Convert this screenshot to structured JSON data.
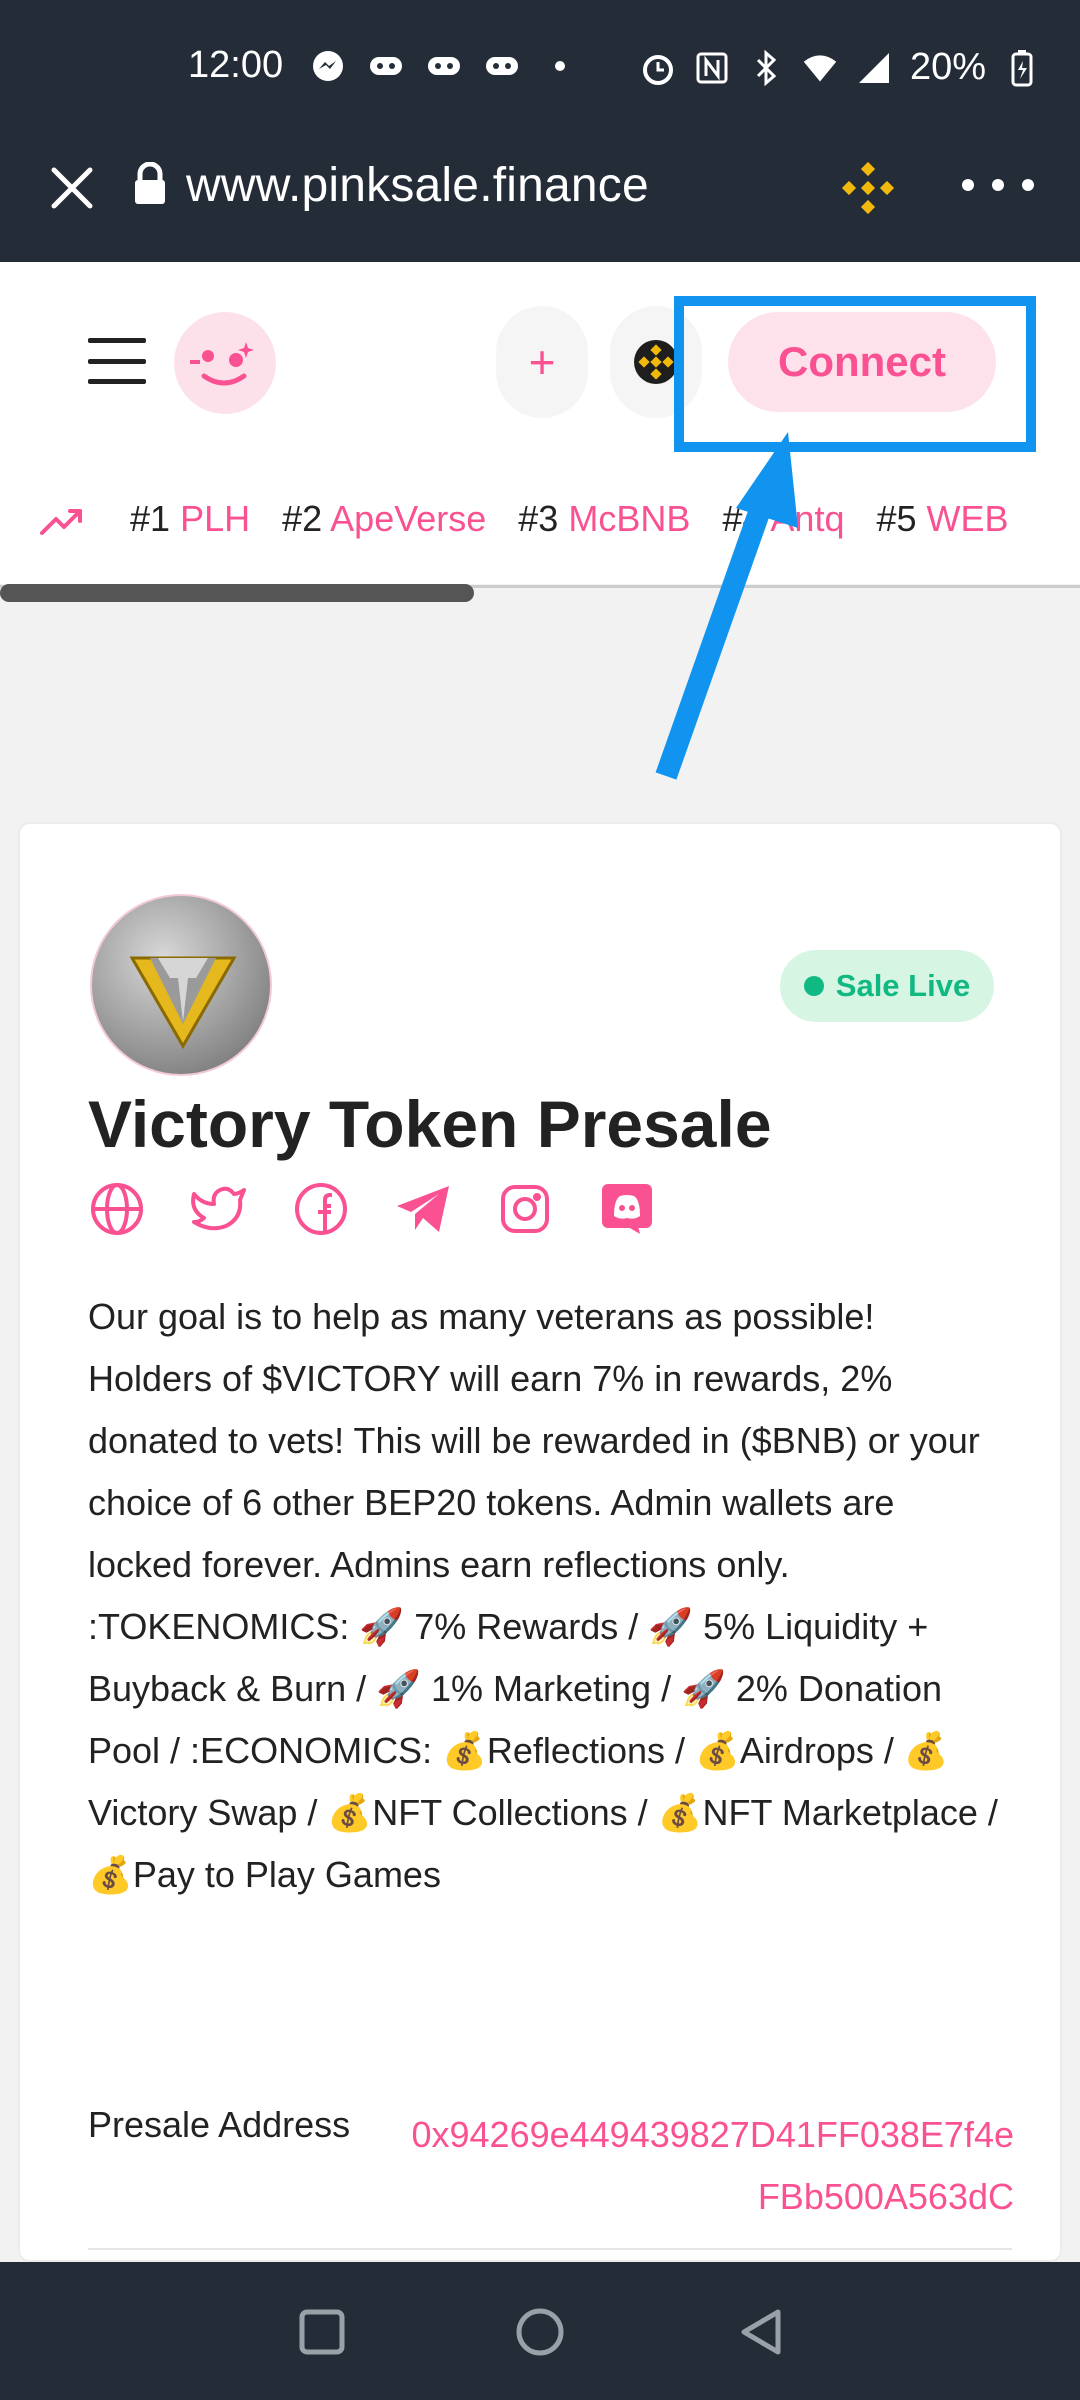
{
  "status_bar": {
    "time": "12:00",
    "battery": "20%"
  },
  "browser": {
    "url": "www.pinksale.finance"
  },
  "header": {
    "connect_label": "Connect",
    "add_label": "+"
  },
  "trending": [
    {
      "rank": "#1",
      "name": "PLH"
    },
    {
      "rank": "#2",
      "name": "ApeVerse"
    },
    {
      "rank": "#3",
      "name": "McBNB"
    },
    {
      "rank": "#4",
      "name": "Antq"
    },
    {
      "rank": "#5",
      "name": "WEB"
    }
  ],
  "presale": {
    "status": "Sale Live",
    "title": "Victory Token Presale",
    "description": "Our goal is to help as many veterans as possible! Holders of $VICTORY will earn 7% in rewards, 2% donated to vets! This will be rewarded in ($BNB) or your choice of 6 other BEP20 tokens. Admin wallets are locked forever. Admins earn reflections only. :TOKENOMICS: 🚀 7% Rewards / 🚀 5% Liquidity + Buyback & Burn / 🚀 1% Marketing / 🚀 2% Donation Pool / :ECONOMICS: 💰Reflections / 💰Airdrops / 💰Victory Swap / 💰NFT Collections / 💰NFT Marketplace / 💰Pay to Play Games",
    "address_label": "Presale Address",
    "address_value": "0x94269e449439827D41FF038E7f4eFBb500A563dC"
  },
  "colors": {
    "accent": "#f95192",
    "live": "#10b981",
    "highlight": "#1194f0",
    "bar": "#242c38"
  },
  "icons": [
    "globe-icon",
    "twitter-icon",
    "facebook-icon",
    "telegram-icon",
    "instagram-icon",
    "discord-icon"
  ]
}
